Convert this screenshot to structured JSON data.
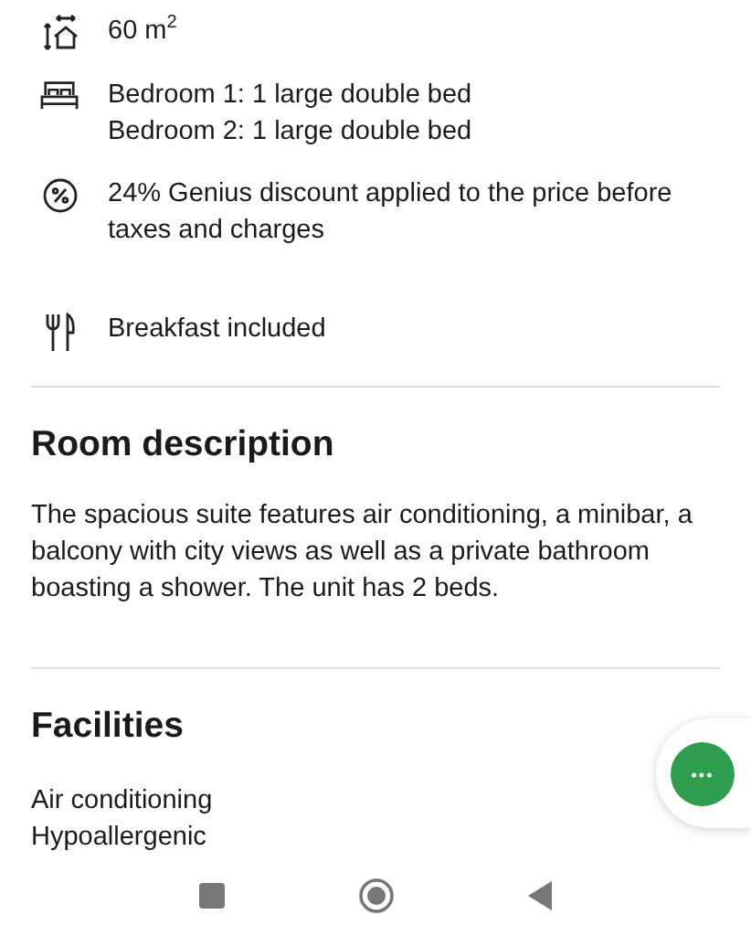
{
  "features": [
    {
      "kind": "size",
      "lines": [
        "60 m$^{2}$"
      ]
    },
    {
      "kind": "bed",
      "lines": [
        "Bedroom 1: 1 large double bed",
        "Bedroom 2: 1 large double bed"
      ]
    },
    {
      "kind": "discount",
      "lines": [
        "24% Genius discount applied to the price before taxes and charges"
      ]
    },
    {
      "kind": "meal",
      "lines": [
        "Breakfast included"
      ]
    }
  ],
  "room_description": {
    "title": "Room description",
    "text": "The spacious suite features air conditioning, a minibar, a balcony with city views as well as a private bathroom boasting a shower. The unit has 2 beds."
  },
  "facilities": {
    "title": "Facilities",
    "items": [
      "Air conditioning",
      "Hypoallergenic"
    ]
  },
  "fab": {
    "label": "•••"
  }
}
